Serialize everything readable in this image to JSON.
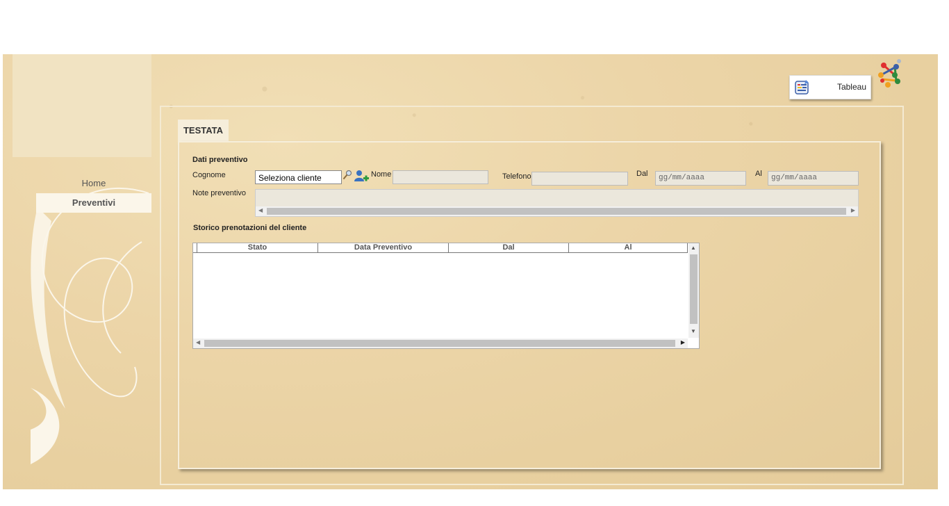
{
  "nav": {
    "home_label": "Home",
    "preventivi_label": "Preventivi"
  },
  "header": {
    "tableau_label": "Tableau"
  },
  "tab": {
    "testata_label": "TESTATA"
  },
  "form": {
    "section_title": "Dati preventivo",
    "cognome_label": "Cognome",
    "cognome_value": "Seleziona cliente",
    "nome_label": "Nome",
    "nome_value": "",
    "telefono_label": "Telefono",
    "telefono_value": "",
    "dal_label": "Dal",
    "dal_placeholder": "gg/mm/aaaa",
    "al_label": "Al",
    "al_placeholder": "gg/mm/aaaa",
    "note_label": "Note preventivo",
    "note_value": ""
  },
  "history": {
    "title": "Storico prenotazioni del cliente",
    "columns": [
      "Stato",
      "Data Preventivo",
      "Dal",
      "Al"
    ],
    "rows": []
  },
  "colors": {
    "background": "#ecd5a8",
    "panel_border": "#f6eedb",
    "input_disabled": "#ebe7dc"
  },
  "icons": {
    "search": "magnifier-icon",
    "add_user": "add-user-icon",
    "tableau": "tableau-icon",
    "brand": "brand-network-icon"
  }
}
